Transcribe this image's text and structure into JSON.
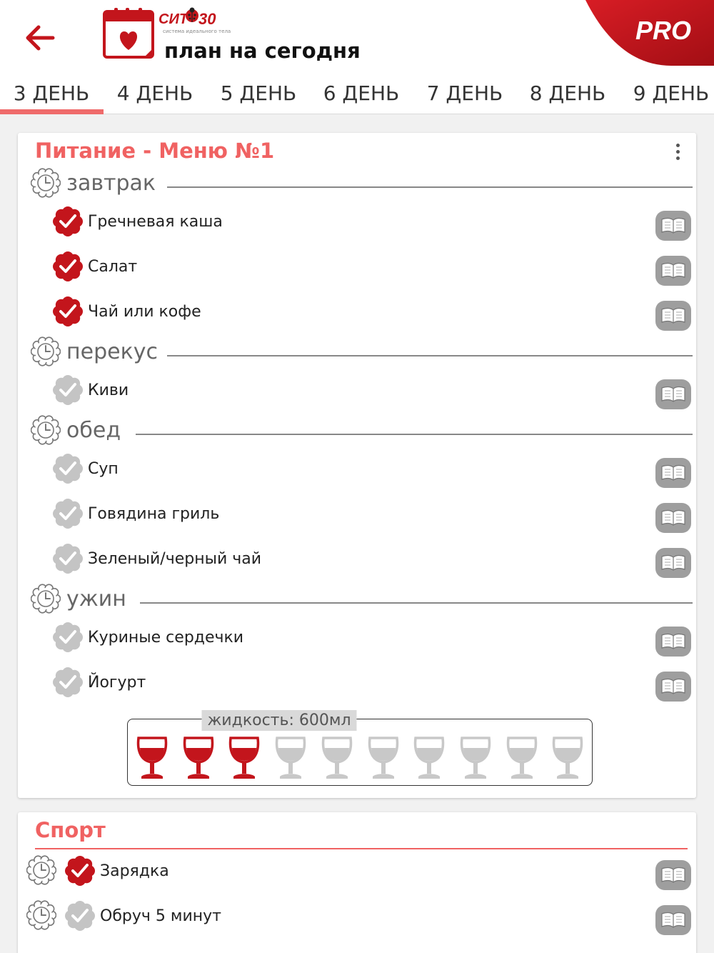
{
  "header": {
    "title": "план на сегодня",
    "logo_text": "СИТ",
    "logo_num": "30",
    "logo_sub": "система идеального тела",
    "pro_label": "PRO"
  },
  "tabs": [
    {
      "label": "3 ДЕНЬ",
      "active": true
    },
    {
      "label": "4 ДЕНЬ",
      "active": false
    },
    {
      "label": "5 ДЕНЬ",
      "active": false
    },
    {
      "label": "6 ДЕНЬ",
      "active": false
    },
    {
      "label": "7 ДЕНЬ",
      "active": false
    },
    {
      "label": "8 ДЕНЬ",
      "active": false
    },
    {
      "label": "9 ДЕНЬ",
      "active": false
    }
  ],
  "nutrition": {
    "title": "Питание - Меню №1",
    "sections": [
      {
        "label": "завтрак",
        "items": [
          {
            "label": "Гречневая каша",
            "checked": true
          },
          {
            "label": "Салат",
            "checked": true
          },
          {
            "label": "Чай или кофе",
            "checked": true
          }
        ]
      },
      {
        "label": "перекус",
        "items": [
          {
            "label": "Киви",
            "checked": false
          }
        ]
      },
      {
        "label": "обед",
        "items": [
          {
            "label": "Суп",
            "checked": false
          },
          {
            "label": "Говядина гриль",
            "checked": false
          },
          {
            "label": "Зеленый/черный чай",
            "checked": false
          }
        ]
      },
      {
        "label": "ужин",
        "items": [
          {
            "label": "Куриные сердечки",
            "checked": false
          },
          {
            "label": "Йогурт",
            "checked": false
          }
        ]
      }
    ],
    "fluid_label": "жидкость: 600мл",
    "glasses_total": 10,
    "glasses_filled": 3
  },
  "sport": {
    "title": "Спорт",
    "items": [
      {
        "label": "Зарядка",
        "checked": true
      },
      {
        "label": "Обруч 5 минут",
        "checked": false
      }
    ]
  },
  "colors": {
    "accent": "#f06262",
    "checked": "#c3151c",
    "unchecked": "#c4c4c4",
    "glass_empty": "#c8c8c8"
  },
  "icons": {
    "back": "arrow-left-icon",
    "calendar": "calendar-heart-icon",
    "clock": "clock-icon",
    "check": "check-badge-icon",
    "recipe": "book-icon",
    "glass": "wine-glass-icon",
    "menu": "more-vertical-icon"
  }
}
